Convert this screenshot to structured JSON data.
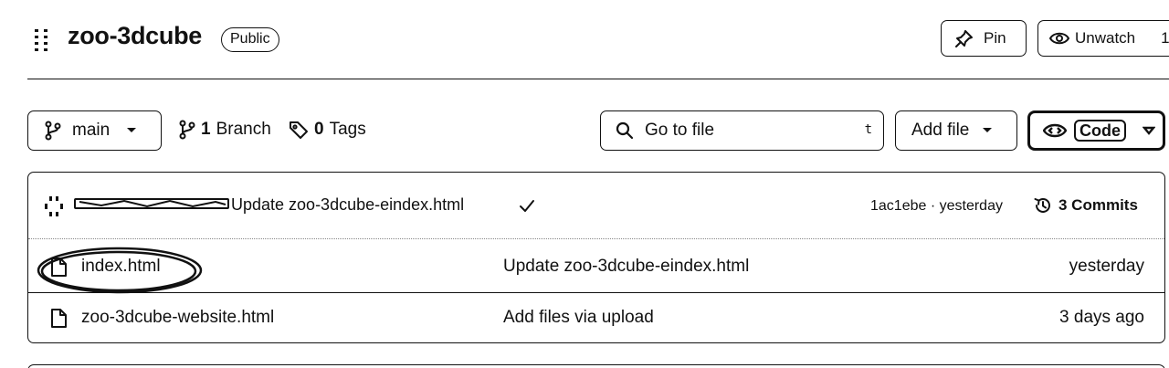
{
  "repo": {
    "name": "zoo-3dcube",
    "visibility": "Public"
  },
  "header": {
    "pin_label": "Pin",
    "watch_label": "Unwatch",
    "watch_count": "1"
  },
  "toolbar": {
    "branch": "main",
    "branch_count": "1",
    "branch_word": "Branch",
    "tag_count": "0",
    "tag_word": "Tags",
    "search_placeholder": "Go to file",
    "search_shortcut": "t",
    "add_file_label": "Add file",
    "code_label": "Code"
  },
  "latest_commit": {
    "message": "Update zoo-3dcube-eindex.html",
    "hash_and_time": "1ac1ebe · yesterday",
    "commits_label": "3 Commits"
  },
  "files": [
    {
      "name": "index.html",
      "commit": "Update zoo-3dcube-eindex.html",
      "date": "yesterday"
    },
    {
      "name": "zoo-3dcube-website.html",
      "commit": "Add files via upload",
      "date": "3 days ago"
    }
  ],
  "colors": {
    "ink": "#111111",
    "background": "#ffffff"
  }
}
